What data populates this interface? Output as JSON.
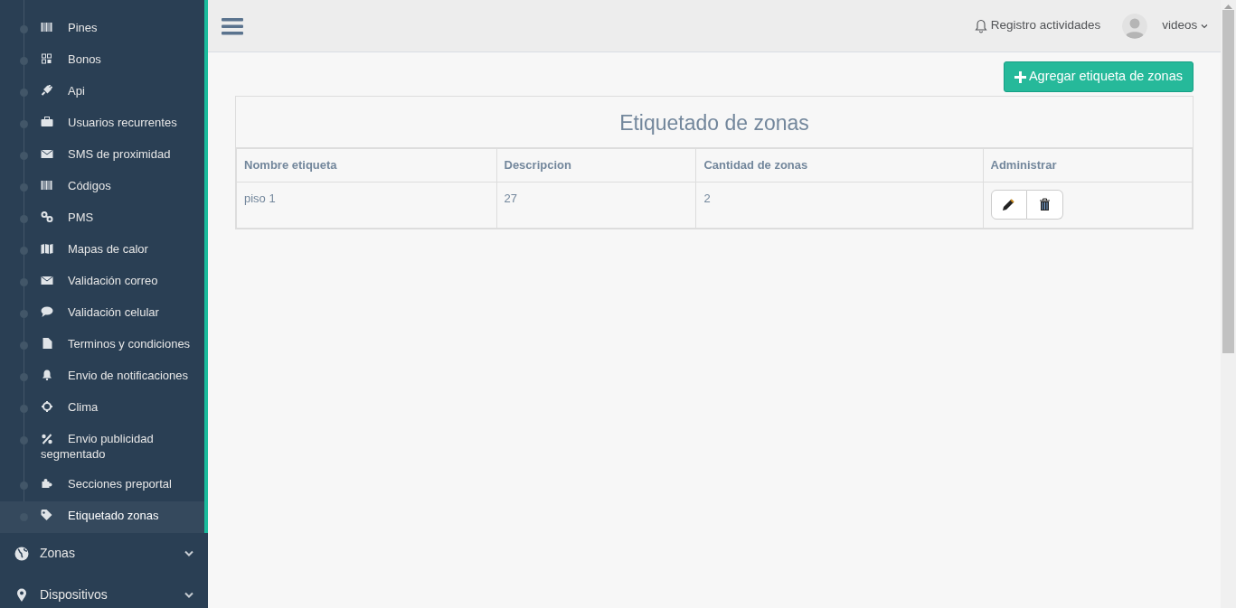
{
  "sidebar": {
    "submenu": [
      {
        "label": "Pines",
        "selected": false
      },
      {
        "label": "Bonos",
        "selected": false
      },
      {
        "label": "Api",
        "selected": false
      },
      {
        "label": "Usuarios recurrentes",
        "selected": false
      },
      {
        "label": "SMS de proximidad",
        "selected": false
      },
      {
        "label": "Códigos",
        "selected": false
      },
      {
        "label": "PMS",
        "selected": false
      },
      {
        "label": "Mapas de calor",
        "selected": false
      },
      {
        "label": "Validación correo",
        "selected": false
      },
      {
        "label": "Validación celular",
        "selected": false
      },
      {
        "label": "Terminos y condiciones",
        "selected": false
      },
      {
        "label": "Envio de notificaciones",
        "selected": false
      },
      {
        "label": "Clima",
        "selected": false
      },
      {
        "label": "Envio publicidad segmentado",
        "selected": false
      },
      {
        "label": "Secciones preportal",
        "selected": false
      },
      {
        "label": "Etiquetado zonas",
        "selected": true
      }
    ],
    "sections": [
      {
        "label": "Zonas",
        "expanded": false
      },
      {
        "label": "Dispositivos",
        "expanded": false
      }
    ]
  },
  "topbar": {
    "activity_link": "Registro actividades",
    "user": "videos"
  },
  "add_button": "Agregar etiqueta de zonas",
  "table": {
    "title": "Etiquetado de zonas",
    "columns": [
      "Nombre etiqueta",
      "Descripcion",
      "Cantidad de zonas",
      "Administrar"
    ],
    "rows": [
      {
        "cells": [
          "piso 1",
          "27",
          "2"
        ]
      }
    ]
  }
}
